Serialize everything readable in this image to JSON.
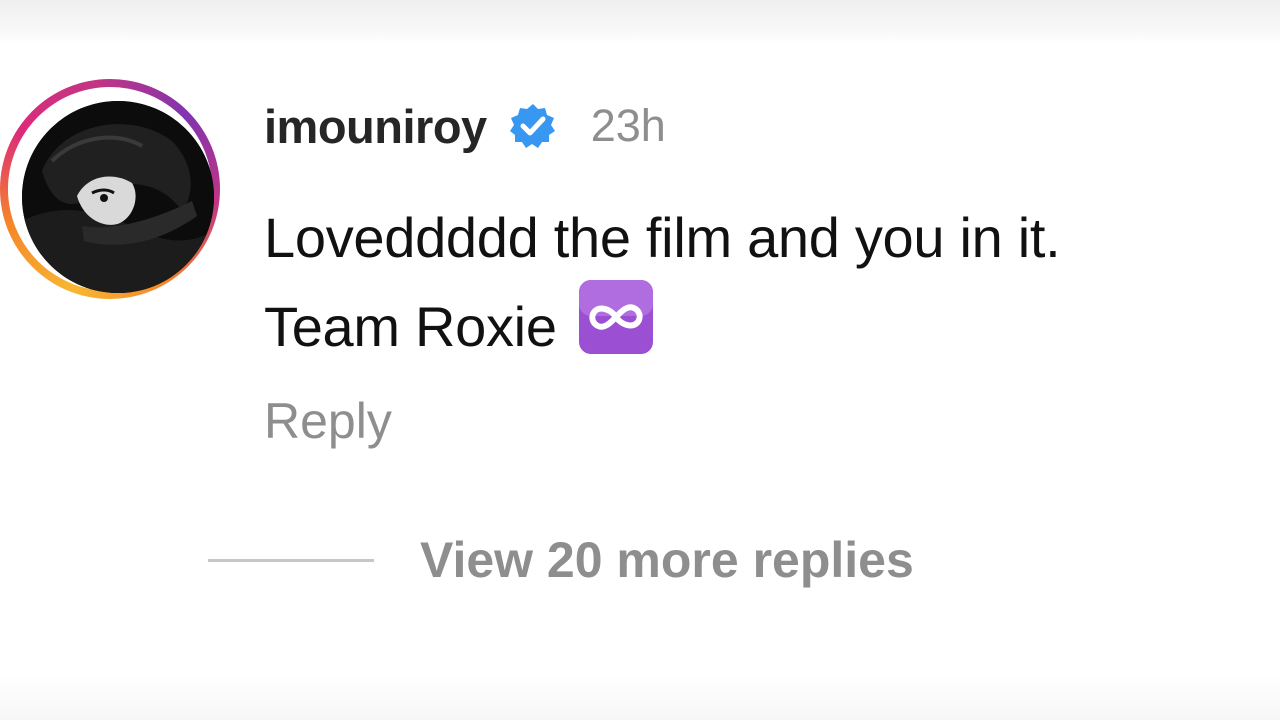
{
  "comment": {
    "username": "imouniroy",
    "verified_icon": "verified-badge-icon",
    "timestamp": "23h",
    "text_line_1": "Loveddddd the film and you in it.",
    "text_line_2": "Team Roxie",
    "emoji": "infinity-emoji-icon",
    "reply_label": "Reply"
  },
  "replies": {
    "view_more_label": "View 20 more replies"
  },
  "colors": {
    "verified_blue": "#3897f0",
    "muted_text": "#8e8e8e",
    "emoji_purple": "#9b4fd3"
  }
}
